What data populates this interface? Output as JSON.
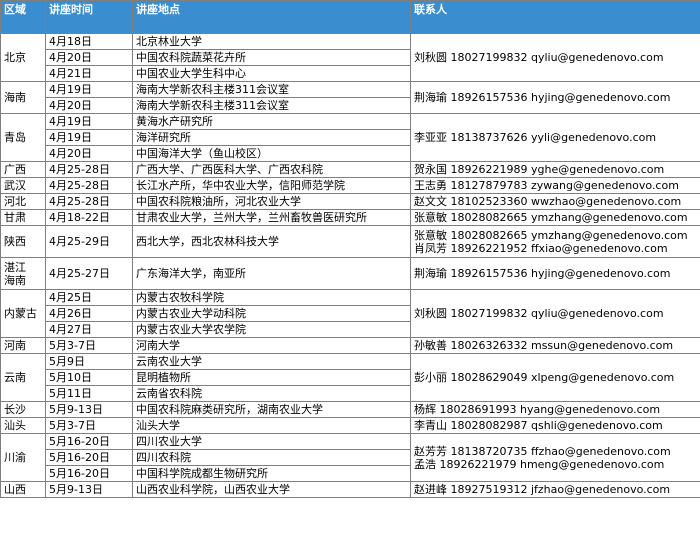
{
  "header": {
    "region": "区域",
    "time": "讲座时间",
    "place": "讲座地点",
    "contact": "联系人"
  },
  "groups": [
    {
      "region": "北京",
      "contact": "刘秋圆 18027199832 qyliu@genedenovo.com",
      "rows": [
        {
          "time": "4月18日",
          "place": "北京林业大学"
        },
        {
          "time": "4月20日",
          "place": "中国农科院蔬菜花卉所"
        },
        {
          "time": "4月21日",
          "place": "中国农业大学生科中心"
        }
      ]
    },
    {
      "region": "海南",
      "contact": "荆海瑜 18926157536 hyjing@genedenovo.com",
      "rows": [
        {
          "time": "4月19日",
          "place": "海南大学新农科主楼311会议室"
        },
        {
          "time": "4月20日",
          "place": "海南大学新农科主楼311会议室"
        }
      ]
    },
    {
      "region": "青岛",
      "contact": "李亚亚 18138737626 yyli@genedenovo.com",
      "rows": [
        {
          "time": "4月19日",
          "place": "黄海水产研究所"
        },
        {
          "time": "4月19日",
          "place": "海洋研究所"
        },
        {
          "time": "4月20日",
          "place": "中国海洋大学（鱼山校区）"
        }
      ]
    },
    {
      "region": "广西",
      "contact": "贺永国 18926221989 yghe@genedenovo.com",
      "rows": [
        {
          "time": "4月25-28日",
          "place": "广西大学、广西医科大学、广西农科院"
        }
      ]
    },
    {
      "region": "武汉",
      "contact": "王志勇 18127879783 zywang@genedenovo.com",
      "rows": [
        {
          "time": "4月25-28日",
          "place": "长江水产所，华中农业大学，信阳师范学院"
        }
      ]
    },
    {
      "region": "河北",
      "contact": "赵文文 18102523360 wwzhao@genedenovo.com",
      "rows": [
        {
          "time": "4月25-28日",
          "place": "中国农科院粮油所，河北农业大学"
        }
      ]
    },
    {
      "region": "甘肃",
      "contact": "张意敏 18028082665 ymzhang@genedenovo.com",
      "rows": [
        {
          "time": "4月18-22日",
          "place": "甘肃农业大学，兰州大学，兰州畜牧兽医研究所"
        }
      ]
    },
    {
      "region": "陕西",
      "contact": "张意敏 18028082665  ymzhang@genedenovo.com",
      "contact2": "肖凤芳 18926221952 ffxiao@genedenovo.com",
      "tall": true,
      "rows": [
        {
          "time": "4月25-29日",
          "place": "西北大学，西北农林科技大学"
        }
      ]
    },
    {
      "region": "湛江",
      "region2": "海南",
      "contact": "荆海瑜 18926157536 hyjing@genedenovo.com",
      "tall": true,
      "rows": [
        {
          "time": "4月25-27日",
          "place": "广东海洋大学，南亚所"
        }
      ]
    },
    {
      "region": "内蒙古",
      "contact": "刘秋圆 18027199832 qyliu@genedenovo.com",
      "rows": [
        {
          "time": "4月25日",
          "place": "内蒙古农牧科学院"
        },
        {
          "time": "4月26日",
          "place": "内蒙古农业大学动科院"
        },
        {
          "time": "4月27日",
          "place": "内蒙古农业大学农学院"
        }
      ]
    },
    {
      "region": "河南",
      "contact": "孙敏善 18026326332 mssun@genedenovo.com",
      "rows": [
        {
          "time": "5月3-7日",
          "place": "河南大学"
        }
      ]
    },
    {
      "region": "云南",
      "contact": "彭小丽 18028629049 xlpeng@genedenovo.com",
      "rows": [
        {
          "time": "5月9日",
          "place": "云南农业大学"
        },
        {
          "time": "5月10日",
          "place": "昆明植物所"
        },
        {
          "time": "5月11日",
          "place": "云南省农科院"
        }
      ]
    },
    {
      "region": "长沙",
      "contact": "杨辉 18028691993 hyang@genedenovo.com",
      "rows": [
        {
          "time": "5月9-13日",
          "place": "中国农科院麻类研究所，湖南农业大学"
        }
      ]
    },
    {
      "region": "汕头",
      "contact": "李青山 18028082987 qshli@genedenovo.com",
      "rows": [
        {
          "time": "5月3-7日",
          "place": "汕头大学"
        }
      ]
    },
    {
      "region": "川渝",
      "contact": "赵芳芳 18138720735 ffzhao@genedenovo.com",
      "contact2": "孟浩 18926221979 hmeng@genedenovo.com",
      "rows": [
        {
          "time": "5月16-20日",
          "place": "四川农业大学"
        },
        {
          "time": "5月16-20日",
          "place": "四川农科院"
        },
        {
          "time": "5月16-20日",
          "place": "中国科学院成都生物研究所"
        }
      ]
    },
    {
      "region": "山西",
      "contact": "赵进峰 18927519312 jfzhao@genedenovo.com",
      "rows": [
        {
          "time": "5月9-13日",
          "place": "山西农业科学院，山西农业大学"
        }
      ]
    }
  ]
}
